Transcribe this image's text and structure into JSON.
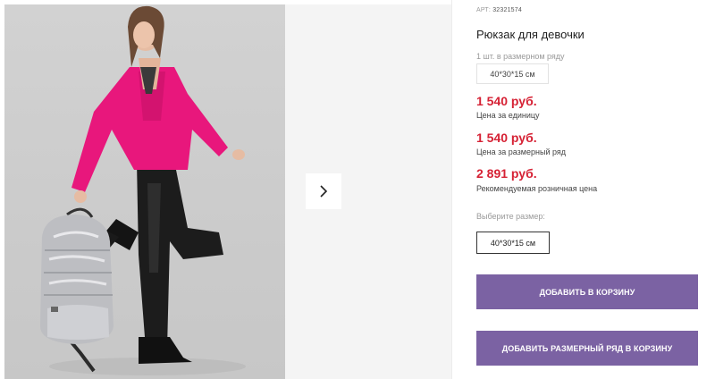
{
  "product": {
    "art_label": "АРТ:",
    "art_value": "32321574",
    "title": "Рюкзак для девочки",
    "pack_note": "1 шт. в размерном ряду",
    "pack_size": "40*30*15 см"
  },
  "prices": [
    {
      "value": "1 540 руб.",
      "label": "Цена за единицу"
    },
    {
      "value": "1 540 руб.",
      "label": "Цена за размерный ряд"
    },
    {
      "value": "2 891 руб.",
      "label": "Рекомендуемая розничная цена"
    }
  ],
  "size": {
    "prompt": "Выберите размер:",
    "selected": "40*30*15 см"
  },
  "actions": {
    "add_to_cart": "ДОБАВИТЬ В КОРЗИНУ",
    "add_size_row": "ДОБАВИТЬ РАЗМЕРНЫЙ РЯД В КОРЗИНУ"
  },
  "colors": {
    "price": "#d62235",
    "button": "#7b62a3"
  },
  "gallery": {
    "next_icon": "chevron-right-icon",
    "photo_alt": "product-photo"
  }
}
